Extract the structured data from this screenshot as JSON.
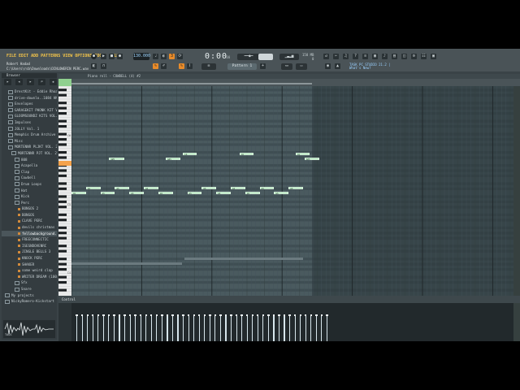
{
  "menu": [
    "FILE",
    "EDIT",
    "ADD",
    "PATTERNS",
    "VIEW",
    "OPTIONS",
    "TOOLS",
    "HELP"
  ],
  "hint": "Robert Hadad",
  "path": "C:\\Users\\rsb\\Downloads\\DINLOWERIN PERC.wav",
  "transport": {
    "time": "0:00",
    "time_sub": ":00",
    "tempo": "130.000",
    "pattern": "Pattern 1",
    "mem": [
      "158 MB",
      "0"
    ]
  },
  "news": [
    "TASK PC STUDIO 21.2 |",
    "What's New?"
  ],
  "browser": {
    "title": "Browser",
    "items": [
      {
        "label": "DrestKit - Eddie Rhoades",
        "type": "folder",
        "indent": 1
      },
      {
        "label": "drive-downlo..1084 HNZ-NBT",
        "type": "folder",
        "indent": 1
      },
      {
        "label": "Envelopes",
        "type": "folder",
        "indent": 1
      },
      {
        "label": "GARAGEKIT PHONK KIT VOL.1",
        "type": "folder",
        "indent": 1
      },
      {
        "label": "GLOOMSOUNDZ KITS VOL.1",
        "type": "folder",
        "indent": 1
      },
      {
        "label": "Impulses",
        "type": "folder",
        "indent": 1
      },
      {
        "label": "JOLLY Vol. 1",
        "type": "folder",
        "indent": 1
      },
      {
        "label": "Memphis Drum Archive",
        "type": "folder",
        "indent": 1
      },
      {
        "label": "Misc",
        "type": "folder",
        "indent": 1
      },
      {
        "label": "MORTENNR PLJKT VOL. 2",
        "type": "folder",
        "indent": 1
      },
      {
        "label": "MORTENNR PJT VOL. 2",
        "type": "folder",
        "indent": 2
      },
      {
        "label": "808",
        "type": "folder",
        "indent": 3
      },
      {
        "label": "Acapella",
        "type": "folder",
        "indent": 3
      },
      {
        "label": "Clap",
        "type": "folder",
        "indent": 3
      },
      {
        "label": "Cowbell",
        "type": "folder",
        "indent": 3
      },
      {
        "label": "Drum Loops",
        "type": "folder",
        "indent": 3
      },
      {
        "label": "Hat",
        "type": "folder",
        "indent": 3
      },
      {
        "label": "Kick",
        "type": "folder",
        "indent": 3
      },
      {
        "label": "Perc",
        "type": "folder",
        "indent": 3
      },
      {
        "label": "BONGOS 2",
        "type": "file",
        "indent": 4
      },
      {
        "label": "BONGOS",
        "type": "file",
        "indent": 4
      },
      {
        "label": "CLAVE PERC",
        "type": "file",
        "indent": 4
      },
      {
        "label": "devils christmas",
        "type": "file",
        "indent": 4
      },
      {
        "label": "fellowbackground.pers",
        "type": "file",
        "indent": 4,
        "selected": true
      },
      {
        "label": "FREECONNECTIC",
        "type": "file",
        "indent": 4
      },
      {
        "label": "ISESNDOVENRC",
        "type": "file",
        "indent": 4
      },
      {
        "label": "JINGLE BELLS 3",
        "type": "file",
        "indent": 4
      },
      {
        "label": "KNOCK PERC",
        "type": "file",
        "indent": 4
      },
      {
        "label": "SHAKER",
        "type": "file",
        "indent": 4
      },
      {
        "label": "some weird clap",
        "type": "file",
        "indent": 4
      },
      {
        "label": "WRITER DREAM (100p",
        "type": "file",
        "indent": 4
      },
      {
        "label": "Sfx",
        "type": "folder",
        "indent": 3
      },
      {
        "label": "Snare",
        "type": "folder",
        "indent": 3
      },
      {
        "label": "My projects",
        "type": "folder",
        "indent": 0
      },
      {
        "label": "NickyRomero-Kickstart",
        "type": "folder",
        "indent": 0
      }
    ],
    "wave_tag": "TAGS"
  },
  "pianoroll": {
    "title": "Piano roll - COWBELL (4) #2",
    "event_label": "Control",
    "octave_labels": [
      "C6",
      "C5",
      "C4"
    ],
    "notes": [
      {
        "label": "A#5",
        "beat": 8.6,
        "pitch": "high",
        "len": 3.4
      },
      {
        "label": "A#5",
        "beat": 21.5,
        "pitch": "high",
        "len": 3.4
      },
      {
        "label": "C6",
        "beat": 25.4,
        "pitch": "top",
        "len": 3.2
      },
      {
        "label": "C6",
        "beat": 38.3,
        "pitch": "top",
        "len": 3.2
      },
      {
        "label": "C6",
        "beat": 51.1,
        "pitch": "top",
        "len": 3.2
      },
      {
        "label": "A#5",
        "beat": 53.1,
        "pitch": "high",
        "len": 3.4
      },
      {
        "label": "G5",
        "beat": 0.0,
        "pitch": "low",
        "len": 3.3
      },
      {
        "label": "A5",
        "beat": 3.3,
        "pitch": "mid",
        "len": 3.3
      },
      {
        "label": "G5",
        "beat": 6.6,
        "pitch": "low",
        "len": 3.3
      },
      {
        "label": "A5",
        "beat": 9.9,
        "pitch": "mid",
        "len": 3.3
      },
      {
        "label": "G5",
        "beat": 13.2,
        "pitch": "low",
        "len": 3.3
      },
      {
        "label": "A5",
        "beat": 16.5,
        "pitch": "mid",
        "len": 3.3
      },
      {
        "label": "G5",
        "beat": 19.8,
        "pitch": "low",
        "len": 3.3
      },
      {
        "label": "G5",
        "beat": 26.4,
        "pitch": "low",
        "len": 3.3
      },
      {
        "label": "A5",
        "beat": 29.7,
        "pitch": "mid",
        "len": 3.3
      },
      {
        "label": "G5",
        "beat": 33.0,
        "pitch": "low",
        "len": 3.3
      },
      {
        "label": "A5",
        "beat": 36.3,
        "pitch": "mid",
        "len": 3.3
      },
      {
        "label": "G5",
        "beat": 39.6,
        "pitch": "low",
        "len": 3.3
      },
      {
        "label": "A5",
        "beat": 42.9,
        "pitch": "mid",
        "len": 3.3
      },
      {
        "label": "G5",
        "beat": 46.2,
        "pitch": "low",
        "len": 3.3
      },
      {
        "label": "A5",
        "beat": 49.5,
        "pitch": "mid",
        "len": 3.3
      }
    ],
    "velocity_count": 48
  }
}
